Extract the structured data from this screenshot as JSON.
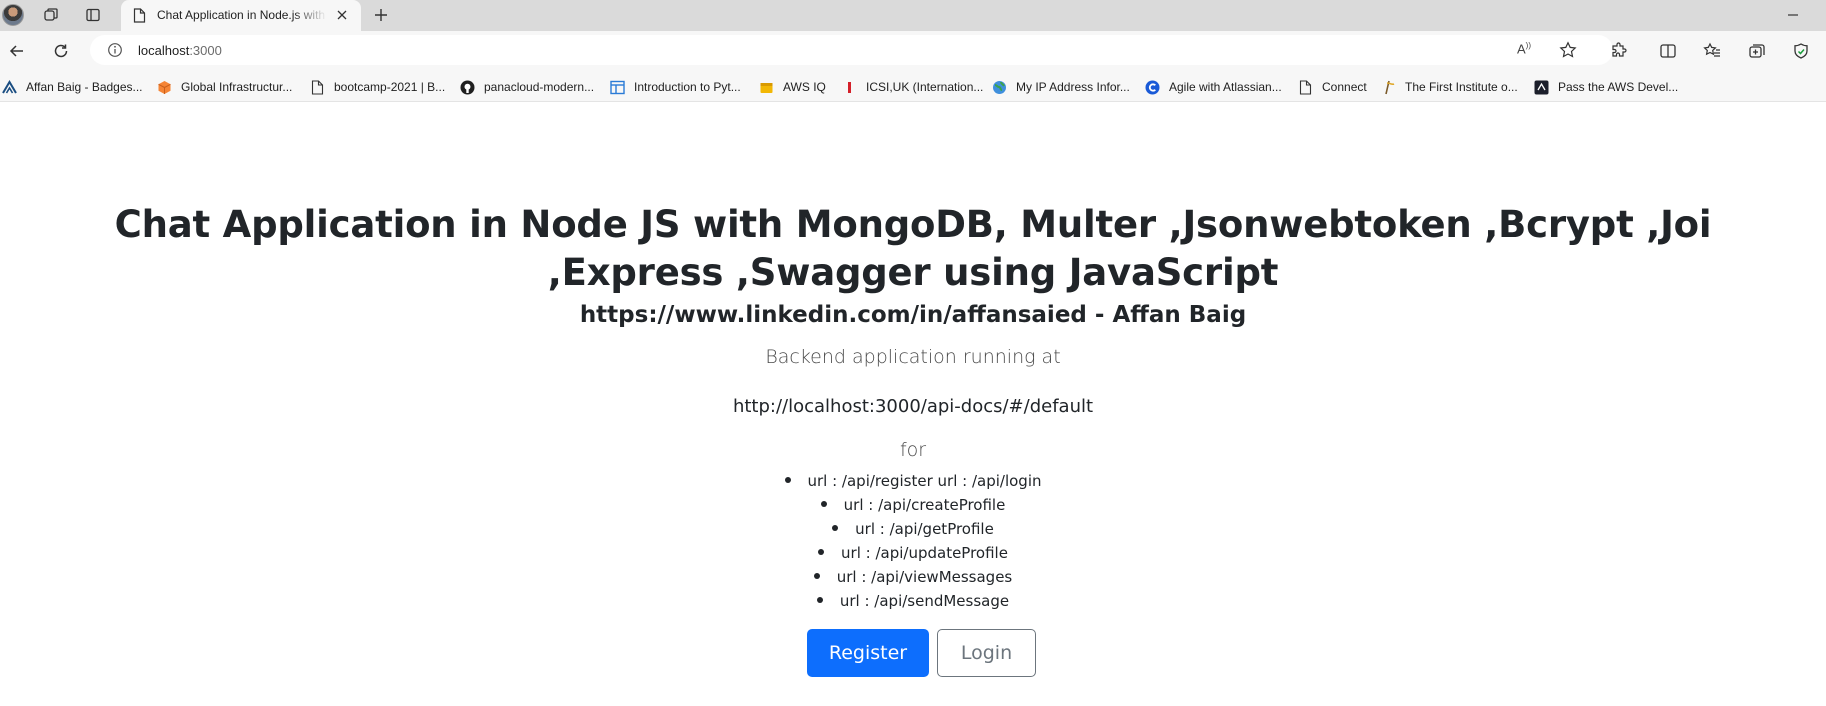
{
  "browser": {
    "tab_title": "Chat Application in Node.js with",
    "url_host": "localhost",
    "url_port": ":3000",
    "bookmarks": [
      {
        "label": "Affan Baig - Badges...",
        "icon": "credly-icon"
      },
      {
        "label": "Global Infrastructur...",
        "icon": "aws-cube-icon"
      },
      {
        "label": "bootcamp-2021 | B...",
        "icon": "page-icon"
      },
      {
        "label": "panacloud-modern...",
        "icon": "github-icon"
      },
      {
        "label": "Introduction to Pyt...",
        "icon": "table-icon"
      },
      {
        "label": "AWS IQ",
        "icon": "aws-box-icon"
      },
      {
        "label": "ICSI,UK (Internation...",
        "icon": "icsi-icon"
      },
      {
        "label": "My IP Address Infor...",
        "icon": "globe-icon"
      },
      {
        "label": "Agile with Atlassian...",
        "icon": "coursera-icon"
      },
      {
        "label": "Connect",
        "icon": "page-icon"
      },
      {
        "label": "The First Institute o...",
        "icon": "institute-icon"
      },
      {
        "label": "Pass the AWS Devel...",
        "icon": "aws-dev-icon"
      }
    ]
  },
  "page": {
    "title": "Chat Application in Node JS with MongoDB, Multer ,Jsonwebtoken ,Bcrypt ,Joi ,Express ,Swagger using JavaScript",
    "subtitle": "https://www.linkedin.com/in/affansaied - Affan Baig",
    "lead": "Backend application running at",
    "api_docs_link": "http://localhost:3000/api-docs/#/default",
    "for_text": "for",
    "endpoints": [
      "url : /api/register url : /api/login",
      "url : /api/createProfile",
      "url : /api/getProfile",
      "url : /api/updateProfile",
      "url : /api/viewMessages",
      "url : /api/sendMessage"
    ],
    "register_label": "Register",
    "login_label": "Login"
  },
  "colors": {
    "primary": "#0d6efd",
    "secondary": "#6c757d",
    "text": "#212529"
  }
}
